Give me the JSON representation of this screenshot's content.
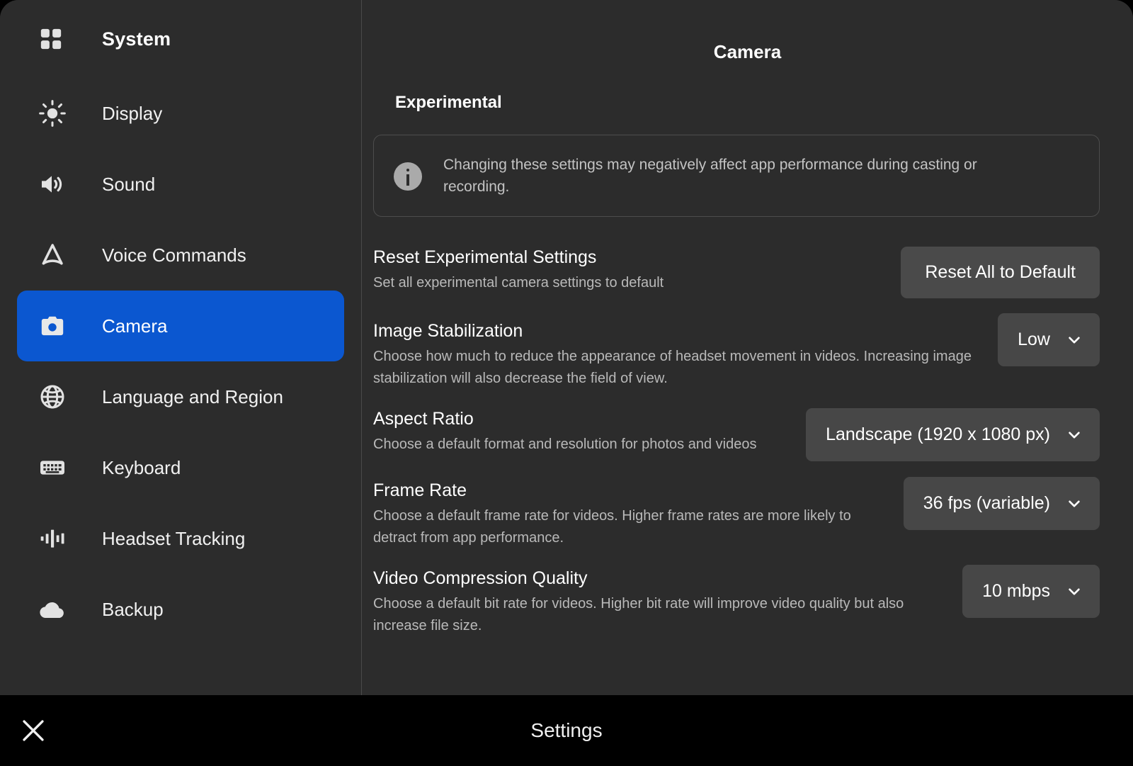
{
  "sidebar": {
    "header": {
      "title": "System",
      "icon": "grid-icon"
    },
    "items": [
      {
        "label": "Display",
        "icon": "brightness-icon",
        "active": false
      },
      {
        "label": "Sound",
        "icon": "speaker-icon",
        "active": false
      },
      {
        "label": "Voice Commands",
        "icon": "triangle-voice-icon",
        "active": false
      },
      {
        "label": "Camera",
        "icon": "camera-icon",
        "active": true
      },
      {
        "label": "Language and Region",
        "icon": "globe-icon",
        "active": false
      },
      {
        "label": "Keyboard",
        "icon": "keyboard-icon",
        "active": false
      },
      {
        "label": "Headset Tracking",
        "icon": "waveform-icon",
        "active": false
      },
      {
        "label": "Backup",
        "icon": "cloud-icon",
        "active": false
      }
    ]
  },
  "content": {
    "title": "Camera",
    "section_title": "Experimental",
    "info": {
      "icon": "info-icon",
      "text": "Changing these settings may negatively affect app performance during casting or recording."
    },
    "rows": [
      {
        "title": "Reset Experimental Settings",
        "desc": "Set all experimental camera settings to default",
        "control_type": "button",
        "control_label": "Reset All to Default"
      },
      {
        "title": "Image Stabilization",
        "desc": "Choose how much to reduce the appearance of headset movement in videos. Increasing image stabilization will also decrease the field of view.",
        "control_type": "dropdown",
        "control_label": "Low"
      },
      {
        "title": "Aspect Ratio",
        "desc": "Choose a default format and resolution for photos and videos",
        "control_type": "dropdown",
        "control_label": "Landscape (1920 x 1080 px)"
      },
      {
        "title": "Frame Rate",
        "desc": "Choose a default frame rate for videos. Higher frame rates are more likely to detract from app performance.",
        "control_type": "dropdown",
        "control_label": "36 fps (variable)"
      },
      {
        "title": "Video Compression Quality",
        "desc": "Choose a default bit rate for videos. Higher bit rate will improve video quality but also increase file size.",
        "control_type": "dropdown",
        "control_label": "10 mbps"
      }
    ]
  },
  "bottombar": {
    "title": "Settings",
    "close_icon": "close-icon"
  },
  "colors": {
    "accent": "#0b57d0",
    "panel_bg": "#2c2c2c",
    "control_bg": "#474747",
    "bottom_bg": "#000000",
    "text_primary": "#ffffff",
    "text_secondary": "#b9b9b9"
  }
}
